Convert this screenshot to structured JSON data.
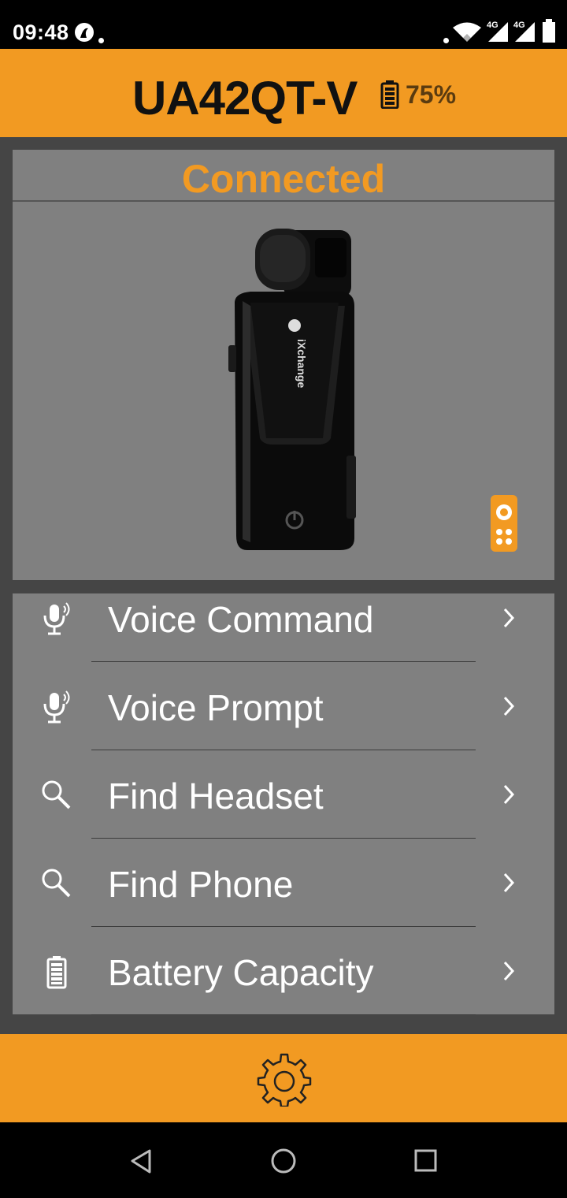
{
  "status_bar": {
    "time": "09:48",
    "network_1": "4G",
    "network_2": "4G"
  },
  "header": {
    "device_name": "UA42QT-V",
    "battery_percent": "75%",
    "battery_level": 0.75
  },
  "device": {
    "connection_status": "Connected",
    "product_brand": "iXchange"
  },
  "menu": {
    "items": [
      {
        "label": "Voice Command",
        "icon": "microphone-icon"
      },
      {
        "label": "Voice Prompt",
        "icon": "microphone-icon"
      },
      {
        "label": "Find Headset",
        "icon": "search-icon"
      },
      {
        "label": "Find Phone",
        "icon": "search-icon"
      },
      {
        "label": "Battery Capacity",
        "icon": "battery-icon"
      }
    ]
  },
  "colors": {
    "accent": "#f29a22",
    "panel": "#808080",
    "background": "#454545"
  }
}
